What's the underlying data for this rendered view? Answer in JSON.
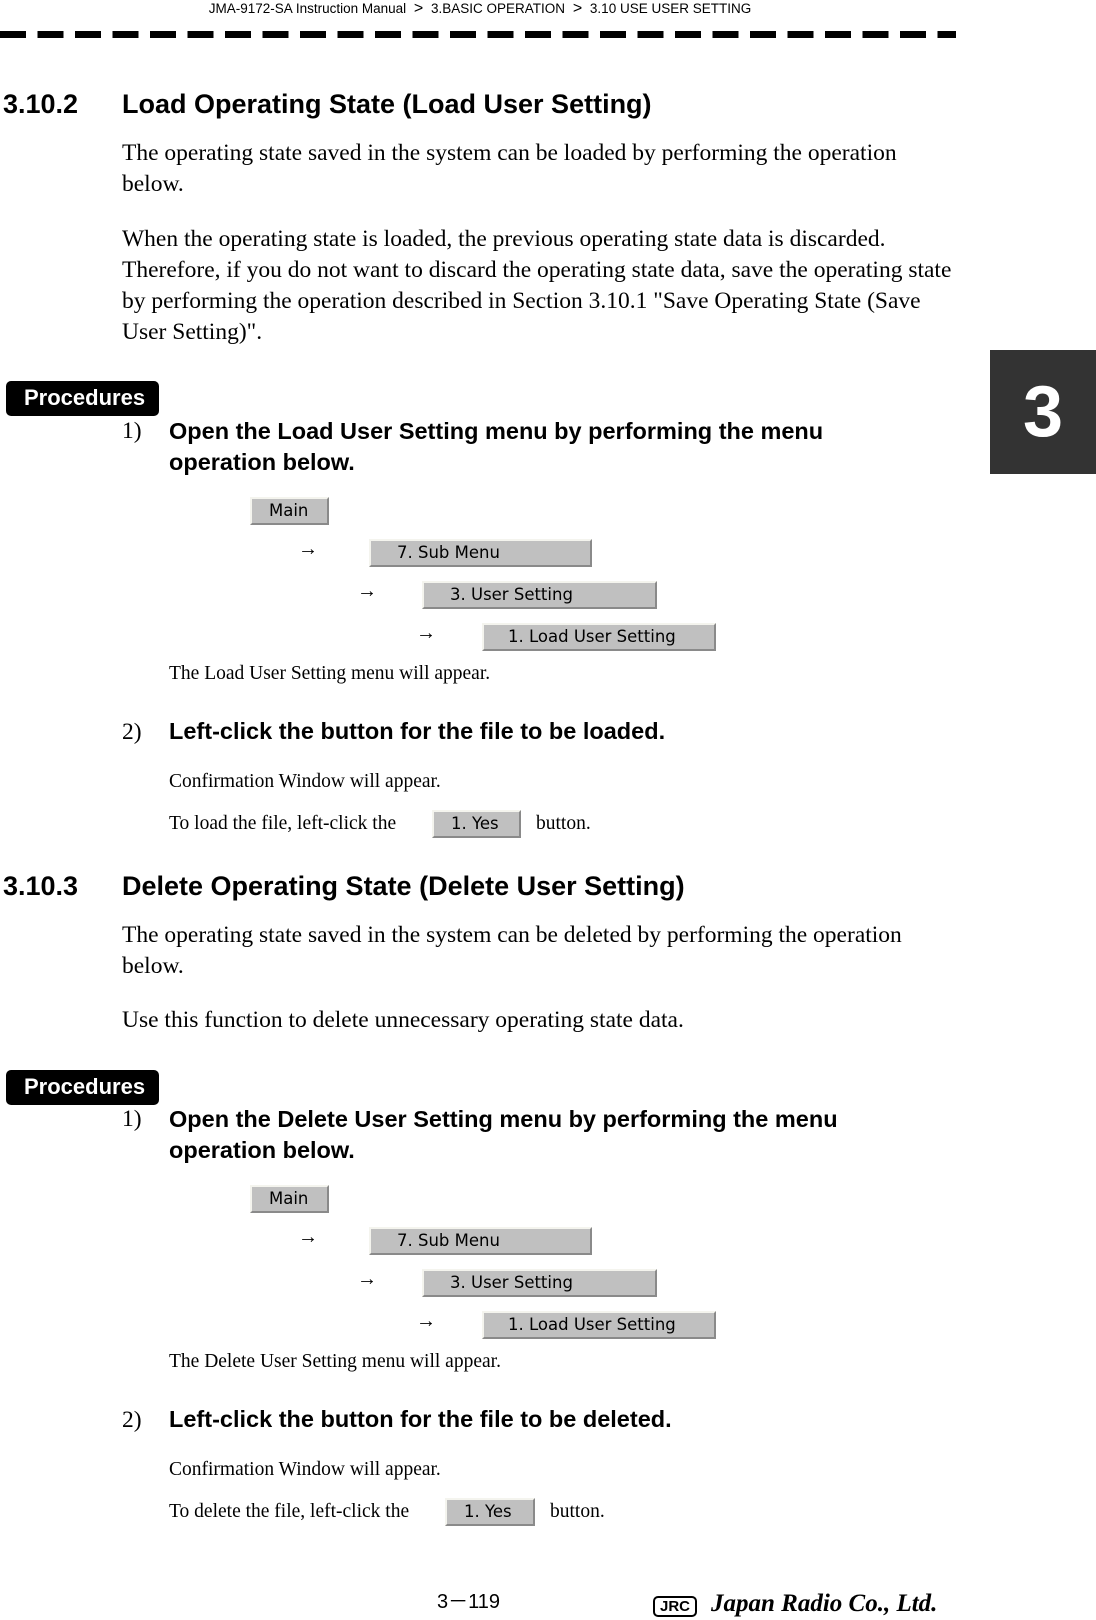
{
  "header": {
    "crumbs": [
      "JMA-9172-SA Instruction Manual",
      "3.BASIC OPERATION",
      "3.10  USE USER SETTING"
    ],
    "separator": ">"
  },
  "chapter_tab": "3",
  "section_3_10_2": {
    "number": "3.10.2",
    "title": "Load Operating State (Load User Setting)",
    "paragraphs": [
      "The operating state saved in the system can be loaded by performing the operation below.",
      "When the operating state is loaded, the previous operating state data is discarded. Therefore, if you do not want to discard the operating state data, save the operating state by performing the operation described in Section 3.10.1 \"Save Operating State (Save User Setting)\"."
    ],
    "procedures_label": "Procedures",
    "steps": [
      {
        "num": "1)",
        "text": "Open the Load User Setting menu by performing the menu operation below.",
        "menu_path": [
          "Main",
          "7. Sub Menu",
          "3. User Setting",
          "1. Load User Setting"
        ],
        "arrow": "→",
        "result": "The Load User Setting menu will appear."
      },
      {
        "num": "2)",
        "text": "Left-click the button for the file to be loaded.",
        "result": "Confirmation Window will appear.",
        "instruction_before": "To load the file, left-click the",
        "button_label": "1. Yes",
        "instruction_after": "button."
      }
    ]
  },
  "section_3_10_3": {
    "number": "3.10.3",
    "title": "Delete Operating State (Delete User Setting)",
    "paragraphs": [
      "The operating state saved in the system can be deleted by performing the operation below.",
      "Use this function to delete unnecessary operating state data."
    ],
    "procedures_label": "Procedures",
    "steps": [
      {
        "num": "1)",
        "text": "Open the Delete User Setting menu by performing the menu operation below.",
        "menu_path": [
          "Main",
          "7. Sub Menu",
          "3. User Setting",
          "1. Load User Setting"
        ],
        "arrow": "→",
        "result": "The Delete User Setting menu will appear."
      },
      {
        "num": "2)",
        "text": "Left-click the button for the file to be deleted.",
        "result": "Confirmation Window will appear.",
        "instruction_before": "To delete the file, left-click the",
        "button_label": "1. Yes",
        "instruction_after": "button."
      }
    ]
  },
  "footer": {
    "page_number": "3－119",
    "logo_mark": "JRC",
    "company_name": "Japan Radio Co., Ltd."
  }
}
